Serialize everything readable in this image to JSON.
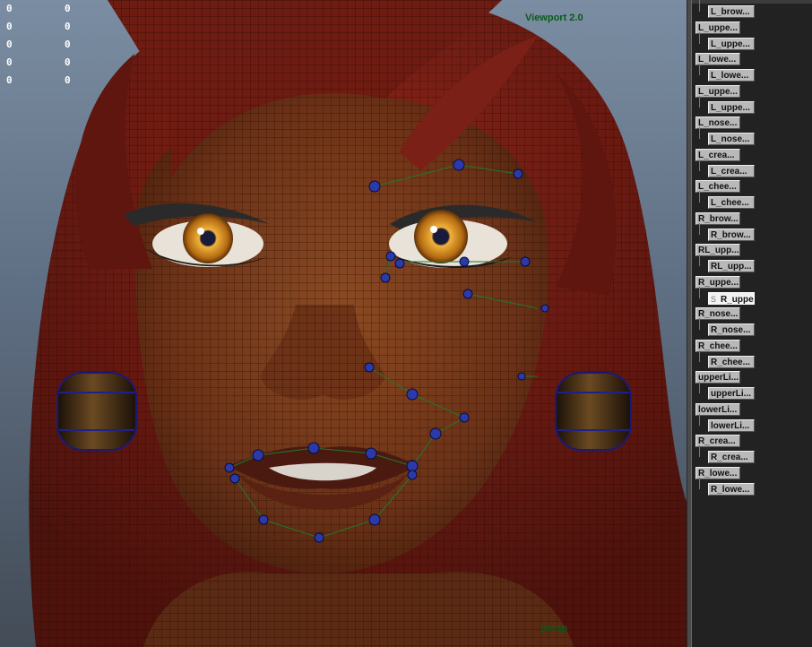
{
  "viewport": {
    "renderer_label": "Viewport 2.0",
    "camera_label": "persp",
    "hud_left": [
      "0",
      "0",
      "0",
      "0",
      "0"
    ],
    "hud_right": [
      "0",
      "0",
      "0",
      "0",
      "0"
    ]
  },
  "outliner": {
    "items": [
      {
        "label": "L_brow...",
        "level": 1
      },
      {
        "label": "L_uppe...",
        "level": 0
      },
      {
        "label": "L_uppe...",
        "level": 1
      },
      {
        "label": "L_lowe...",
        "level": 0
      },
      {
        "label": "L_lowe...",
        "level": 1
      },
      {
        "label": "L_uppe...",
        "level": 0
      },
      {
        "label": "L_uppe...",
        "level": 1
      },
      {
        "label": "L_nose...",
        "level": 0
      },
      {
        "label": "L_nose...",
        "level": 1
      },
      {
        "label": "L_crea...",
        "level": 0
      },
      {
        "label": "L_crea...",
        "level": 1
      },
      {
        "label": "L_chee...",
        "level": 0
      },
      {
        "label": "L_chee...",
        "level": 1
      },
      {
        "label": "R_brow...",
        "level": 0
      },
      {
        "label": "R_brow...",
        "level": 1
      },
      {
        "label": "RL_upp...",
        "level": 0
      },
      {
        "label": "RL_upp...",
        "level": 1
      },
      {
        "label": "R_uppe...",
        "level": 0
      },
      {
        "label": "R_uppe...",
        "level": 1,
        "selected": true
      },
      {
        "label": "R_nose...",
        "level": 0
      },
      {
        "label": "R_nose...",
        "level": 1
      },
      {
        "label": "R_chee...",
        "level": 0
      },
      {
        "label": "R_chee...",
        "level": 1
      },
      {
        "label": "upperLi...",
        "level": 0
      },
      {
        "label": "upperLi...",
        "level": 1
      },
      {
        "label": "lowerLi...",
        "level": 0
      },
      {
        "label": "lowerLi...",
        "level": 1
      },
      {
        "label": "R_crea...",
        "level": 0
      },
      {
        "label": "R_crea...",
        "level": 1
      },
      {
        "label": "R_lowe...",
        "level": 0
      },
      {
        "label": "R_lowe...",
        "level": 1
      }
    ]
  },
  "colors": {
    "hair": "#6b1a12",
    "skin": "#7a3b1c",
    "iris": "#d89a2a",
    "control_joint": "#1a2f9a",
    "control_curve": "#1e7a2e",
    "earring": "#3a2412"
  },
  "icons": {
    "selected_item_icon": "select-glyph-icon"
  }
}
